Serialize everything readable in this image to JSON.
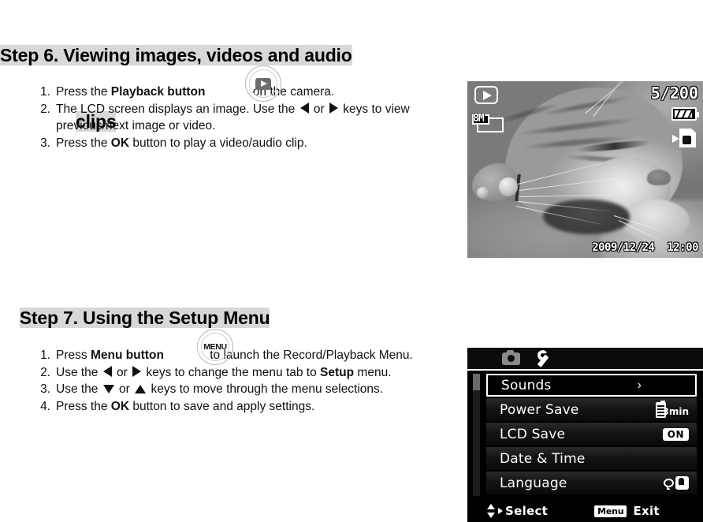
{
  "document": {
    "step6": {
      "heading_line1": "Step 6. Viewing images, videos and audio",
      "heading_line2": "clips",
      "steps": [
        {
          "num": "1.",
          "pre": "Press the ",
          "bold": "Playback button",
          "post": " on the camera."
        },
        {
          "num": "2.",
          "pre": "The LCD screen displays an image. Use the ",
          "mid": " or ",
          "post": " keys to view previous/next image or video."
        },
        {
          "num": "3.",
          "pre": "Press the ",
          "bold": "OK",
          "post": " button to play a video/audio clip."
        }
      ]
    },
    "step7": {
      "heading": "Step 7. Using the Setup Menu",
      "steps": [
        {
          "num": "1.",
          "pre": "Press ",
          "bold": "Menu button",
          "post": " to launch the Record/Playback Menu."
        },
        {
          "num": "2.",
          "pre": "Use the ",
          "mid": " or ",
          "post": " keys to change the menu tab to ",
          "bold": "Setup",
          "tail": " menu."
        },
        {
          "num": "3.",
          "pre": "Use the ",
          "mid": " or ",
          "post": " keys to move through the menu selections."
        },
        {
          "num": "4.",
          "pre": "Press the ",
          "bold": "OK",
          "post": " button to save and apply settings."
        }
      ]
    },
    "buttons": {
      "playback_icon": "playback-button-icon",
      "menu_label": "MENU"
    }
  },
  "photo_screen": {
    "play_icon": "play-mode-icon",
    "resolution": "8M",
    "frame_counter": "5/200",
    "battery_icon": "battery-icon",
    "card_icon": "memory-card-icon",
    "timestamp": "2009/12/24  12:00",
    "subject": "grayscale photo of a sleeping cat"
  },
  "setup_menu": {
    "tabs": [
      {
        "name": "record-tab",
        "icon": "camera-icon",
        "active": false
      },
      {
        "name": "setup-tab",
        "icon": "wrench-icon",
        "active": true
      }
    ],
    "rows": [
      {
        "label": "Sounds",
        "value_type": "chevron",
        "value": "›",
        "selected": true
      },
      {
        "label": "Power Save",
        "value_type": "battery",
        "value": "3min",
        "selected": false
      },
      {
        "label": "LCD Save",
        "value_type": "badge",
        "value": "ON",
        "selected": false
      },
      {
        "label": "Date & Time",
        "value_type": "none",
        "value": "",
        "selected": false
      },
      {
        "label": "Language",
        "value_type": "lang",
        "value": "",
        "selected": false
      }
    ],
    "footer": {
      "select_label": "Select",
      "select_icon": "up-down-right-arrows-icon",
      "menu_badge": "Menu",
      "exit_label": "Exit"
    }
  },
  "colors": {
    "highlight": "#d8d8d8",
    "page_bg": "#ffffff",
    "menu_bg": "#000000",
    "menu_text": "#ffffff"
  }
}
